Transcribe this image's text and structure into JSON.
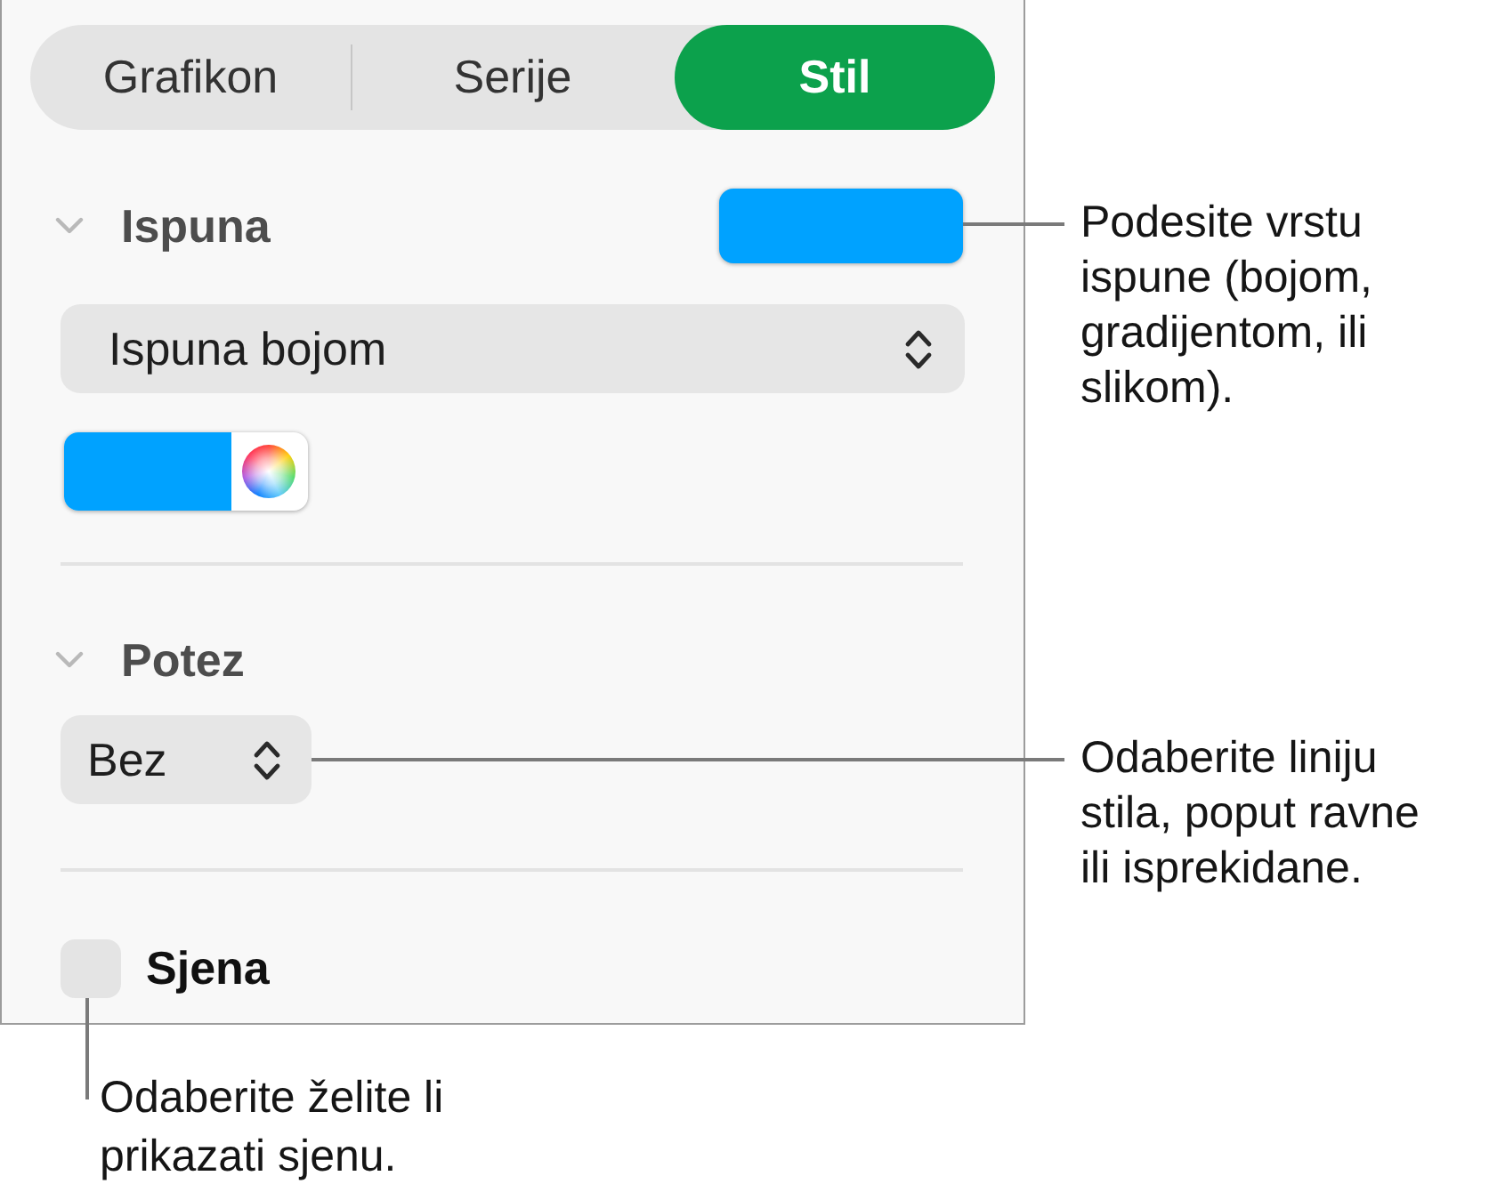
{
  "tabs": [
    {
      "label": "Grafikon",
      "selected": false
    },
    {
      "label": "Serije",
      "selected": false
    },
    {
      "label": "Stil",
      "selected": true
    }
  ],
  "fill_section": {
    "title": "Ispuna",
    "expanded": true,
    "color": "#00a2ff",
    "fill_type": "Ispuna bojom",
    "callout": "Podesite vrstu ispune (bojom, gradijentom, ili slikom)."
  },
  "stroke_section": {
    "title": "Potez",
    "expanded": true,
    "style": "Bez",
    "callout": "Odaberite liniju stila, poput ravne ili isprekidane."
  },
  "shadow": {
    "label": "Sjena",
    "checked": false,
    "callout": "Odaberite želite li prikazati sjenu."
  }
}
